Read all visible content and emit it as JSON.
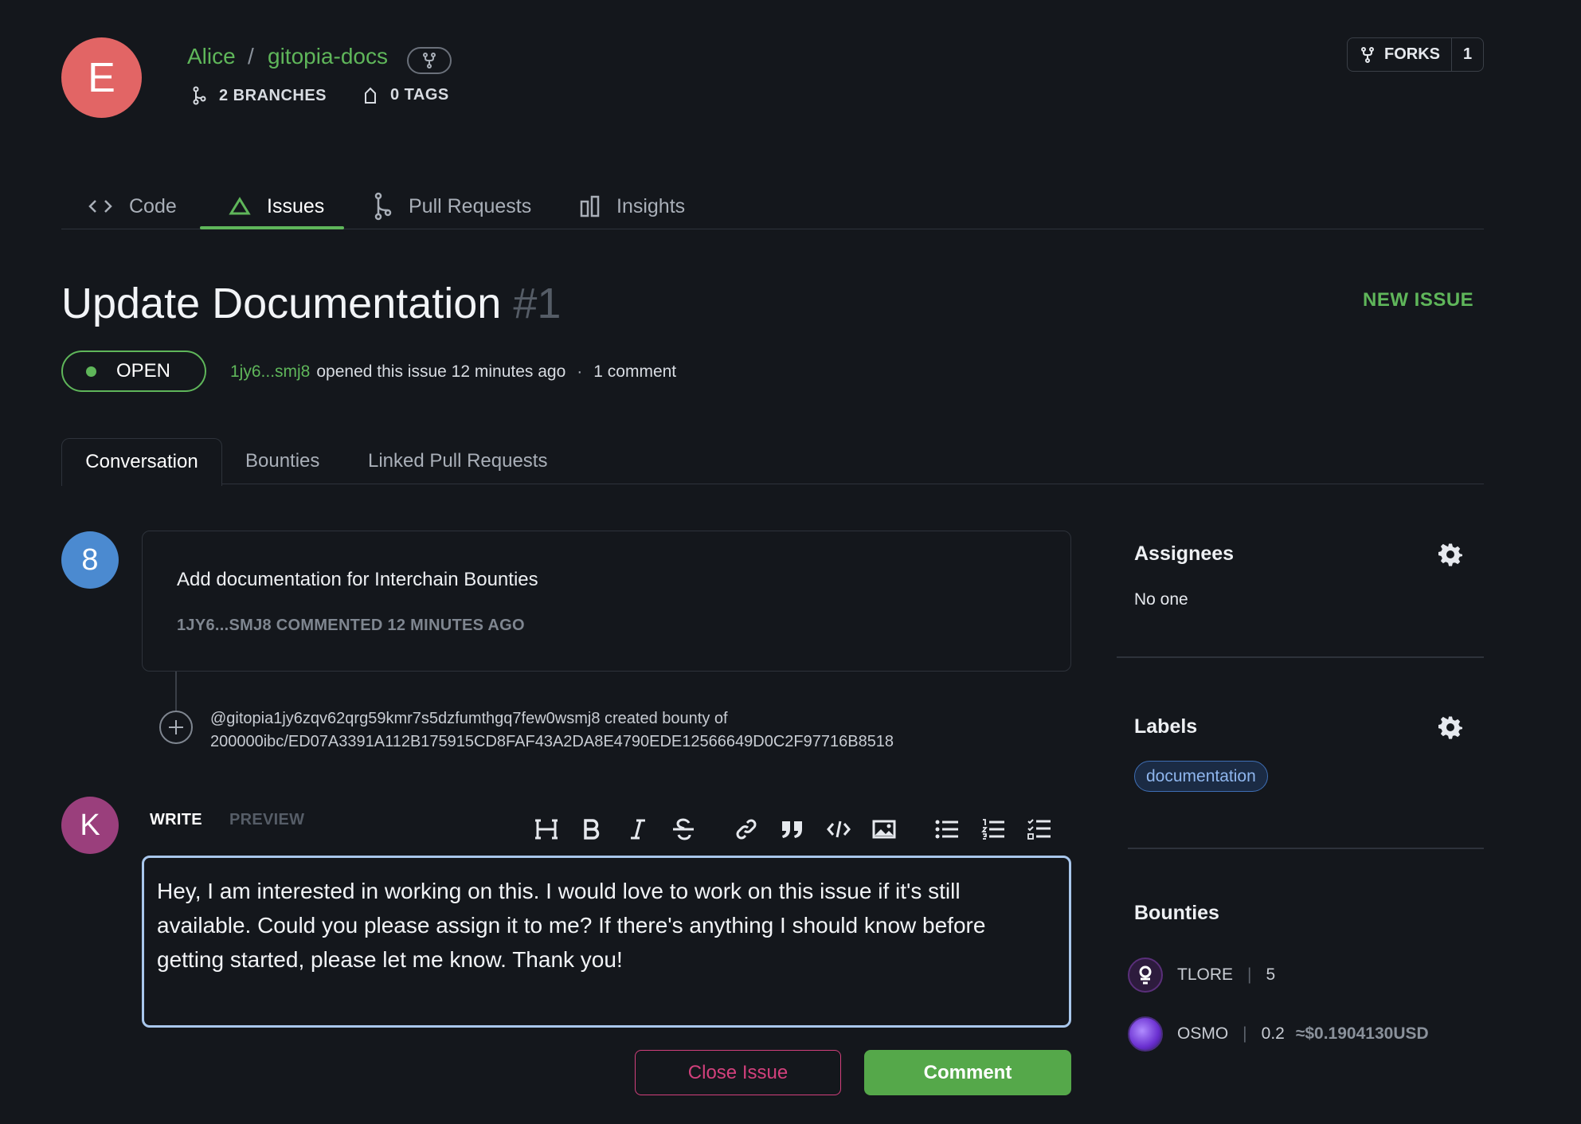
{
  "repo": {
    "avatar_letter": "E",
    "owner": "Alice",
    "separator": "/",
    "name": "gitopia-docs",
    "branches": "2 BRANCHES",
    "tags": "0 TAGS",
    "forks_label": "FORKS",
    "forks_count": "1"
  },
  "nav": {
    "tabs": [
      {
        "label": "Code",
        "icon": "code-icon"
      },
      {
        "label": "Issues",
        "icon": "issue-triangle-icon",
        "active": true
      },
      {
        "label": "Pull Requests",
        "icon": "pull-request-icon"
      },
      {
        "label": "Insights",
        "icon": "insights-icon"
      }
    ]
  },
  "issue": {
    "title": "Update Documentation",
    "number": "#1",
    "new_issue_label": "NEW ISSUE",
    "status": "OPEN",
    "author": "1jy6...smj8",
    "opened_text": "opened this issue 12 minutes ago",
    "dot": "·",
    "comment_count": "1 comment"
  },
  "subtabs": [
    "Conversation",
    "Bounties",
    "Linked Pull Requests"
  ],
  "comment": {
    "avatar_letter": "8",
    "body": "Add documentation for Interchain Bounties",
    "meta": "1JY6...SMJ8 COMMENTED 12 MINUTES AGO"
  },
  "bounty_event": {
    "line1": "@gitopia1jy6zqv62qrg59kmr7s5dzfumthgq7few0wsmj8 created bounty of",
    "line2": "200000ibc/ED07A3391A112B175915CD8FAF43A2DA8E4790EDE12566649D0C2F97716B8518"
  },
  "editor": {
    "avatar_letter": "K",
    "write_label": "WRITE",
    "preview_label": "PREVIEW",
    "text": "Hey, I am interested in working on this. I would love to work on this issue if it's still available. Could you please assign it to me? If there's anything I should know before getting started, please let me know. Thank you!",
    "toolbar": [
      "heading-icon",
      "bold-icon",
      "italic-icon",
      "strikethrough-icon",
      "link-icon",
      "quote-icon",
      "code-icon",
      "image-icon",
      "bullet-list-icon",
      "numbered-list-icon",
      "task-list-icon"
    ],
    "close_label": "Close Issue",
    "comment_label": "Comment"
  },
  "sidebar": {
    "assignees_title": "Assignees",
    "assignees_value": "No one",
    "labels_title": "Labels",
    "labels": [
      "documentation"
    ],
    "bounties_title": "Bounties",
    "bounties": [
      {
        "denom": "TLORE",
        "amount": "5",
        "usd": ""
      },
      {
        "denom": "OSMO",
        "amount": "0.2",
        "usd": "≈$0.1904130USD"
      }
    ]
  },
  "colors": {
    "accent_green": "#5fb65a",
    "danger_pink": "#d2407c",
    "background": "#14171c"
  }
}
